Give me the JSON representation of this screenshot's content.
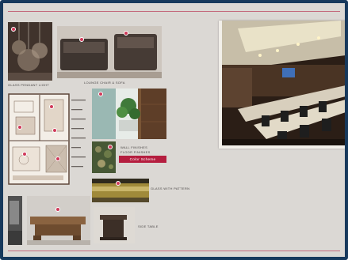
{
  "board": {
    "captions": {
      "pendant": "Glass Pendant Light",
      "lounge": "Lounge Chair & Sofa",
      "wall": "Wall Finishes",
      "finishes": "Floor Finishes",
      "color_scheme": "Color Scheme",
      "glass": "Glass with Pattern",
      "side_table": "Side Table"
    }
  },
  "colors": {
    "frame": "#17395c",
    "board_bg": "#dbd8d4",
    "accent": "#b51e3f",
    "pin": "#d03a5a"
  }
}
